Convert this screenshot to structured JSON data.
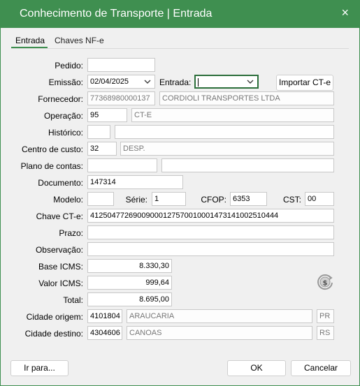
{
  "window": {
    "title": "Conhecimento de Transporte | Entrada",
    "close_icon": "×"
  },
  "tabs": [
    "Entrada",
    "Chaves NF-e"
  ],
  "labels": {
    "pedido": "Pedido:",
    "emissao": "Emissão:",
    "entrada": "Entrada:",
    "fornecedor": "Fornecedor:",
    "operacao": "Operação:",
    "historico": "Histórico:",
    "centro_custo": "Centro de custo:",
    "plano_contas": "Plano de contas:",
    "documento": "Documento:",
    "modelo": "Modelo:",
    "serie": "Série:",
    "cfop": "CFOP:",
    "cst": "CST:",
    "chave": "Chave CT-e:",
    "prazo": "Prazo:",
    "observacao": "Observação:",
    "base_icms": "Base ICMS:",
    "valor_icms": "Valor ICMS:",
    "total": "Total:",
    "cidade_origem": "Cidade origem:",
    "cidade_destino": "Cidade destino:"
  },
  "values": {
    "pedido": "",
    "emissao": "02/04/2025",
    "entrada": "",
    "fornecedor_codigo": "77368980000137",
    "fornecedor_nome": "CORDIOLI TRANSPORTES LTDA",
    "operacao_codigo": "95",
    "operacao_nome": "CT-E",
    "historico_codigo": "",
    "historico_nome": "",
    "centro_codigo": "32",
    "centro_nome": "DESP.",
    "plano_codigo": "",
    "plano_nome": "",
    "documento": "147314",
    "modelo": "",
    "serie": "1",
    "cfop": "6353",
    "cst": "00",
    "chave": "41250477269009000127570010001473141002510444",
    "prazo": "",
    "observacao": "",
    "base_icms": "8.330,30",
    "valor_icms": "999,64",
    "total": "8.695,00",
    "origem_codigo": "4101804",
    "origem_nome": "ARAUCARIA",
    "origem_uf": "PR",
    "destino_codigo": "4304606",
    "destino_nome": "CANOAS",
    "destino_uf": "RS"
  },
  "buttons": {
    "importar": "Importar CT-e",
    "ir_para": "Ir para...",
    "ok": "OK",
    "cancelar": "Cancelar"
  },
  "icons": {
    "dropdown": "chevron-down-icon",
    "refresh_money": "refresh-money-icon"
  }
}
